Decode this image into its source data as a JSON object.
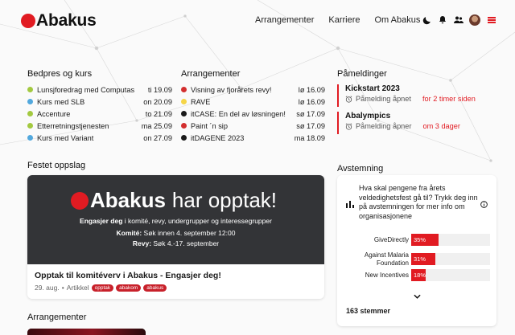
{
  "brand": {
    "name": "Abakus",
    "accent": "#e11b22"
  },
  "nav": [
    "Arrangementer",
    "Karriere",
    "Om Abakus"
  ],
  "header_icons": [
    "moon-icon",
    "bell-icon",
    "users-icon",
    "avatar",
    "menu-icon"
  ],
  "bedpres": {
    "title": "Bedpres og kurs",
    "items": [
      {
        "name": "Lunsjforedrag med Computas",
        "date": "ti 19.09",
        "color": "#a3c940"
      },
      {
        "name": "Kurs med SLB",
        "date": "on 20.09",
        "color": "#52a8dd"
      },
      {
        "name": "Accenture",
        "date": "to 21.09",
        "color": "#a3c940"
      },
      {
        "name": "Etterretningstjenesten",
        "date": "ma 25.09",
        "color": "#a3c940"
      },
      {
        "name": "Kurs med Variant",
        "date": "on 27.09",
        "color": "#52a8dd"
      }
    ]
  },
  "arrangementer": {
    "title": "Arrangementer",
    "items": [
      {
        "name": "Visning av fjorårets revy!",
        "date": "lø 16.09",
        "color": "#d32f2f"
      },
      {
        "name": "RAVE",
        "date": "lø 16.09",
        "color": "#f5d547"
      },
      {
        "name": "itCASE: En del av løsningen!",
        "date": "sø 17.09",
        "color": "#1a1a1a"
      },
      {
        "name": "Paint ´n sip",
        "date": "sø 17.09",
        "color": "#d32f2f"
      },
      {
        "name": "itDAGENE 2023",
        "date": "ma 18.09",
        "color": "#1a1a1a"
      }
    ]
  },
  "pameldinger": {
    "title": "Påmeldinger",
    "items": [
      {
        "name": "Kickstart 2023",
        "status": "Påmelding åpnet",
        "when": "for 2 timer siden"
      },
      {
        "name": "Abalympics",
        "status": "Påmelding åpner",
        "when": "om 3 dager"
      }
    ]
  },
  "featured": {
    "section_title": "Festet oppslag",
    "banner": {
      "brand": "Abakus",
      "headline": "har opptak!",
      "line1_bold": "Engasjer deg",
      "line1_rest": " i komité, revy, undergrupper og interessegrupper",
      "line2_bold": "Komité:",
      "line2_rest": " Søk innen 4. september 12:00",
      "line3_bold": "Revy:",
      "line3_rest": " Søk 4.-17. september"
    },
    "title": "Opptak til komitéverv i Abakus - Engasjer deg!",
    "date": "29. aug.",
    "type": "Artikkel",
    "tags": [
      "opptak",
      "abakom",
      "abakus"
    ]
  },
  "poll": {
    "section_title": "Avstemning",
    "question": "Hva skal pengene fra årets veldedighetsfest gå til? Trykk deg inn på avstemningen for mer info om organisasjonene",
    "options": [
      {
        "label": "GiveDirectly",
        "percent": 35,
        "text": "35%"
      },
      {
        "label": "Against Malaria Foundation",
        "percent": 31,
        "text": "31%"
      },
      {
        "label": "New Incentives",
        "percent": 18,
        "text": "18%"
      }
    ],
    "total": "163 stemmer"
  },
  "bottom_section_title": "Arrangementer"
}
